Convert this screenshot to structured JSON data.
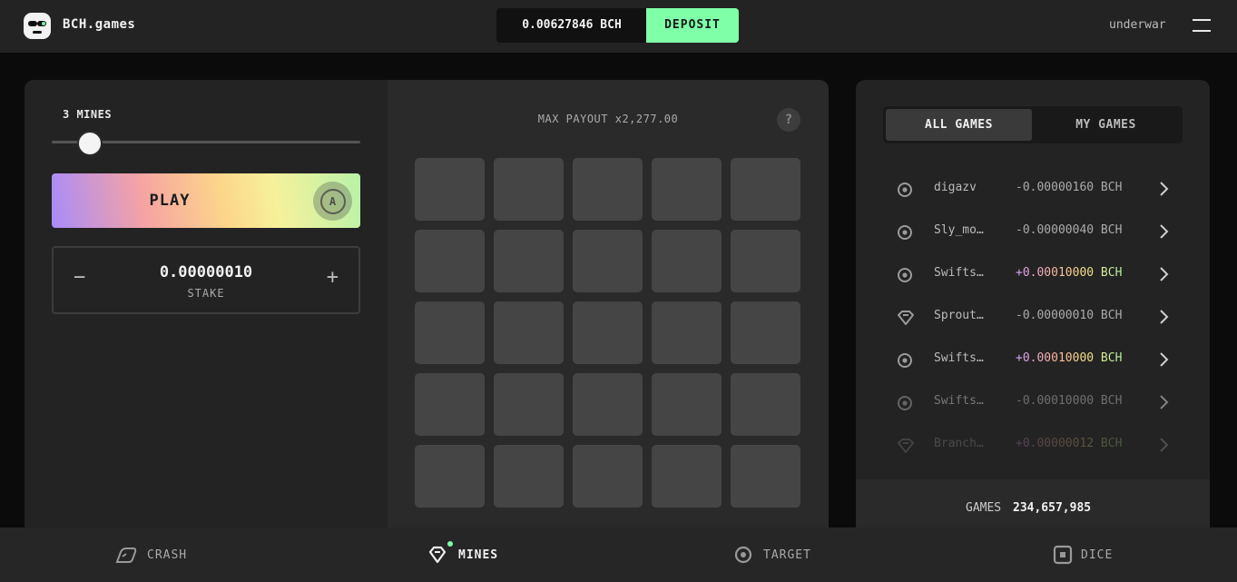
{
  "header": {
    "brand": "BCH.games",
    "balance": "0.00627846 BCH",
    "deposit_label": "DEPOSIT",
    "username": "underwar"
  },
  "controls": {
    "mines_label": "3 MINES",
    "mines_count": 3,
    "play_label": "PLAY",
    "auto_label": "A",
    "stake_value": "0.00000010",
    "stake_label": "STAKE",
    "minus_label": "−",
    "plus_label": "+"
  },
  "board": {
    "max_payout": "MAX PAYOUT x2,277.00",
    "help_label": "?",
    "rows": 5,
    "cols": 5
  },
  "history": {
    "tabs": [
      {
        "label": "ALL GAMES",
        "active": true
      },
      {
        "label": "MY GAMES",
        "active": false
      }
    ],
    "games": [
      {
        "icon": "target-icon",
        "player": "digazv",
        "amount": "-0.00000160 BCH",
        "win": false
      },
      {
        "icon": "target-icon",
        "player": "Sly_mo…",
        "amount": "-0.00000040 BCH",
        "win": false
      },
      {
        "icon": "target-icon",
        "player": "Swifts…",
        "amount": "+0.00010000 BCH",
        "win": true
      },
      {
        "icon": "gem-icon",
        "player": "Sprout…",
        "amount": "-0.00000010 BCH",
        "win": false
      },
      {
        "icon": "target-icon",
        "player": "Swifts…",
        "amount": "+0.00010000 BCH",
        "win": true
      },
      {
        "icon": "target-icon",
        "player": "Swifts…",
        "amount": "-0.00010000 BCH",
        "win": false
      },
      {
        "icon": "gem-icon",
        "player": "Branch…",
        "amount": "+0.00000012 BCH",
        "win": true
      }
    ],
    "total_label": "GAMES",
    "total_value": "234,657,985"
  },
  "nav": [
    {
      "label": "CRASH",
      "icon": "crash-icon",
      "active": false
    },
    {
      "label": "MINES",
      "icon": "gem-icon",
      "active": true
    },
    {
      "label": "TARGET",
      "icon": "target-icon",
      "active": false
    },
    {
      "label": "DICE",
      "icon": "dice-icon",
      "active": false
    }
  ],
  "colors": {
    "accent": "#7effa8",
    "background": "#0b0b0b",
    "panel": "#232323",
    "tile": "#454545"
  }
}
